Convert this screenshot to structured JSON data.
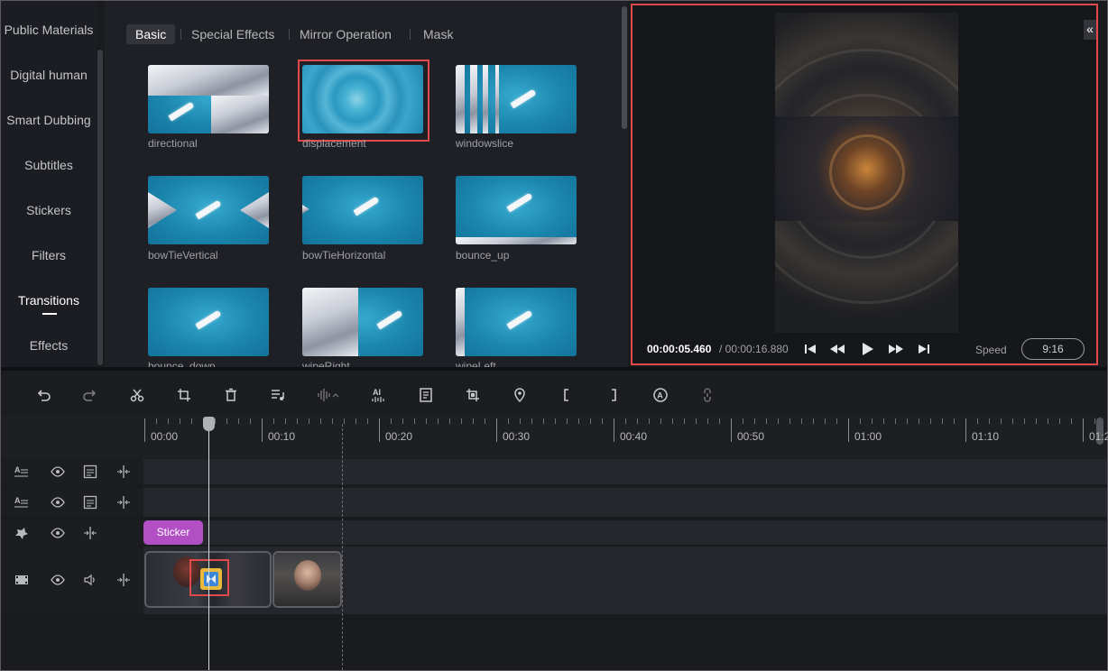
{
  "nav": {
    "items": [
      "Public Materials",
      "Digital human",
      "Smart Dubbing",
      "Subtitles",
      "Stickers",
      "Filters",
      "Transitions",
      "Effects"
    ],
    "active": "Transitions"
  },
  "tabs": [
    "Basic",
    "Special Effects",
    "Mirror Operation",
    "Mask"
  ],
  "transitions": [
    {
      "label": "directional"
    },
    {
      "label": "displacement"
    },
    {
      "label": "windowslice"
    },
    {
      "label": "bowTieVertical"
    },
    {
      "label": "bowTieHorizontal"
    },
    {
      "label": "bounce_up"
    },
    {
      "label": "bounce_down"
    },
    {
      "label": "wipeRight"
    },
    {
      "label": "wipeLeft"
    }
  ],
  "preview": {
    "current_time": "00:00:05.460",
    "total_time": "/ 00:00:16.880",
    "speed_label": "Speed",
    "ratio": "9:16",
    "collapse_icon": "double-chevron-left-icon"
  },
  "ruler": {
    "labels": [
      "00:00",
      "00:10",
      "00:20",
      "00:30",
      "00:40",
      "00:50",
      "01:00",
      "01:10",
      "01:2"
    ]
  },
  "sticker_clip": {
    "label": "Sticker",
    "color": "#b24fc4"
  },
  "colors": {
    "highlight": "#e04a4a",
    "background": "#1a1b1f",
    "panel": "#1f2025"
  }
}
